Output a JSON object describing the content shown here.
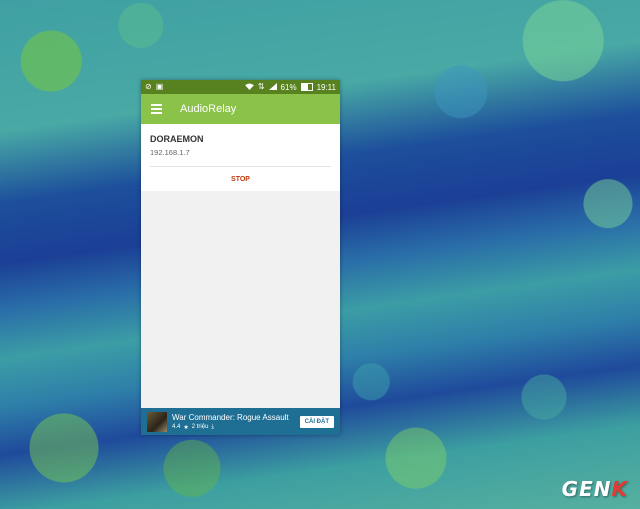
{
  "status_bar": {
    "battery": "61%",
    "time": "19:11",
    "icons": [
      "no-sound-icon",
      "image-icon",
      "wifi-icon",
      "data-arrows-icon",
      "signal-icon",
      "battery-icon"
    ]
  },
  "app_bar": {
    "title": "AudioRelay",
    "color": "#8bc34a"
  },
  "server": {
    "name": "DORAEMON",
    "ip": "192.168.1.7",
    "stop_label": "STOP",
    "stop_color": "#bf360c"
  },
  "ad": {
    "title": "War Commander: Rogue Assault",
    "rating": "4.4",
    "downloads": "2 triệu",
    "install_label": "CÀI ĐẶT"
  },
  "logo": {
    "text_main": "GEN",
    "text_accent": "K"
  }
}
